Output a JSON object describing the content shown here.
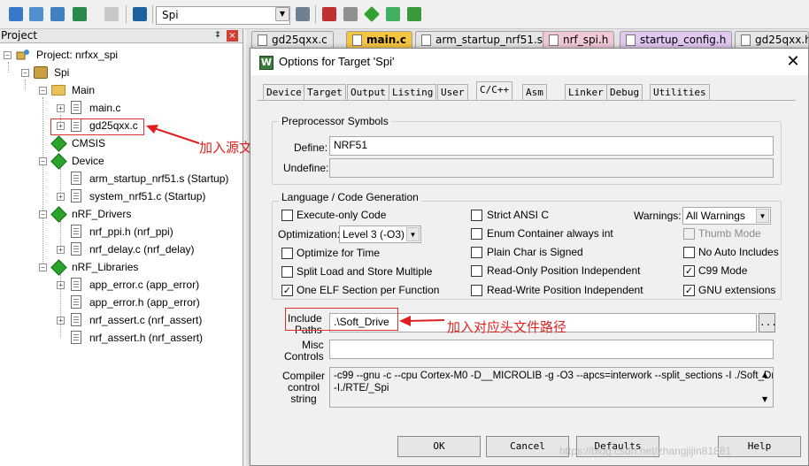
{
  "toolbar": {
    "target": "Spi",
    "icons": [
      "translate-icon",
      "build-icon",
      "rebuild-icon",
      "batch-build-icon",
      "stop-build-icon",
      "load-icon",
      "options-for-target-icon",
      "manage-project-items-icon",
      "select-packs-icon",
      "pack-installer-icon",
      "manage-run-time-env-icon",
      "configure-icon"
    ]
  },
  "project_pane": {
    "title": "Project",
    "pin": "‡",
    "close": "×",
    "tree": [
      {
        "label": "Project: nrfxx_spi",
        "icon": "project-icon"
      },
      {
        "label": "Spi",
        "icon": "target-icon"
      },
      {
        "label": "Main",
        "icon": "folder-icon"
      },
      {
        "label": "main.c",
        "icon": "file-icon"
      },
      {
        "label": "gd25qxx.c",
        "icon": "file-icon"
      },
      {
        "label": "CMSIS",
        "icon": "component-icon"
      },
      {
        "label": "Device",
        "icon": "component-icon"
      },
      {
        "label": "arm_startup_nrf51.s (Startup)",
        "icon": "file-icon"
      },
      {
        "label": "system_nrf51.c (Startup)",
        "icon": "file-icon"
      },
      {
        "label": "nRF_Drivers",
        "icon": "component-icon"
      },
      {
        "label": "nrf_ppi.h (nrf_ppi)",
        "icon": "file-icon"
      },
      {
        "label": "nrf_delay.c (nrf_delay)",
        "icon": "file-icon"
      },
      {
        "label": "nRF_Libraries",
        "icon": "component-icon"
      },
      {
        "label": "app_error.c (app_error)",
        "icon": "file-icon"
      },
      {
        "label": "app_error.h (app_error)",
        "icon": "file-icon"
      },
      {
        "label": "nrf_assert.c (nrf_assert)",
        "icon": "file-icon"
      },
      {
        "label": "nrf_assert.h (nrf_assert)",
        "icon": "file-icon"
      }
    ],
    "annotation": "加入源文件"
  },
  "editor_tabs": [
    {
      "label": "gd25qxx.c",
      "color": "#e6e6e6"
    },
    {
      "label": "main.c",
      "color": "#f5c542"
    },
    {
      "label": "arm_startup_nrf51.s",
      "color": "#e6e6e6"
    },
    {
      "label": "nrf_spi.h",
      "color": "#f0c8d8"
    },
    {
      "label": "startup_config.h",
      "color": "#e0c8f0"
    },
    {
      "label": "gd25qxx.h",
      "color": "#e6e6e6"
    }
  ],
  "dialog": {
    "title": "Options for Target 'Spi'",
    "close": "✕",
    "tabs": [
      "Device",
      "Target",
      "Output",
      "Listing",
      "User",
      "C/C++",
      "Asm",
      "Linker",
      "Debug",
      "Utilities"
    ],
    "active_tab": "C/C++",
    "preprocessor": {
      "legend": "Preprocessor Symbols",
      "define_label": "Define:",
      "define_value": "NRF51",
      "undefine_label": "Undefine:",
      "undefine_value": ""
    },
    "language": {
      "legend": "Language / Code Generation",
      "execute_only": {
        "label": "Execute-only Code",
        "checked": false
      },
      "optimization_label": "Optimization:",
      "optimization_value": "Level 3 (-O3)",
      "optimize_time": {
        "label": "Optimize for Time",
        "checked": false
      },
      "split_load": {
        "label": "Split Load and Store Multiple",
        "checked": false
      },
      "one_elf": {
        "label": "One ELF Section per Function",
        "checked": true
      },
      "strict_ansi": {
        "label": "Strict ANSI C",
        "checked": false
      },
      "enum_container": {
        "label": "Enum Container always int",
        "checked": false
      },
      "plain_char": {
        "label": "Plain Char is Signed",
        "checked": false
      },
      "read_only_pi": {
        "label": "Read-Only Position Independent",
        "checked": false
      },
      "read_write_pi": {
        "label": "Read-Write Position Independent",
        "checked": false
      },
      "warnings_label": "Warnings:",
      "warnings_value": "All Warnings",
      "thumb_mode": {
        "label": "Thumb Mode",
        "checked": false,
        "disabled": true
      },
      "no_auto_includes": {
        "label": "No Auto Includes",
        "checked": false
      },
      "c99_mode": {
        "label": "C99 Mode",
        "checked": true
      },
      "gnu_extensions": {
        "label": "GNU extensions",
        "checked": true
      }
    },
    "include_paths_label_1": "Include",
    "include_paths_label_2": "Paths",
    "include_paths_value": ".\\Soft_Drive",
    "browse": "...",
    "misc_label_1": "Misc",
    "misc_label_2": "Controls",
    "misc_value": "",
    "compiler_label_1": "Compiler",
    "compiler_label_2": "control",
    "compiler_label_3": "string",
    "compiler_line_1": "-c99 --gnu -c --cpu Cortex-M0 -D__MICROLIB -g -O3 --apcs=interwork --split_sections -I ./Soft_Drive",
    "compiler_line_2": "-I./RTE/_Spi",
    "annotation": "加入对应头文件路径",
    "buttons": {
      "ok": "OK",
      "cancel": "Cancel",
      "defaults": "Defaults",
      "help": "Help"
    },
    "watermark": "https://blog.csdn.net/zhangjijin81881"
  }
}
